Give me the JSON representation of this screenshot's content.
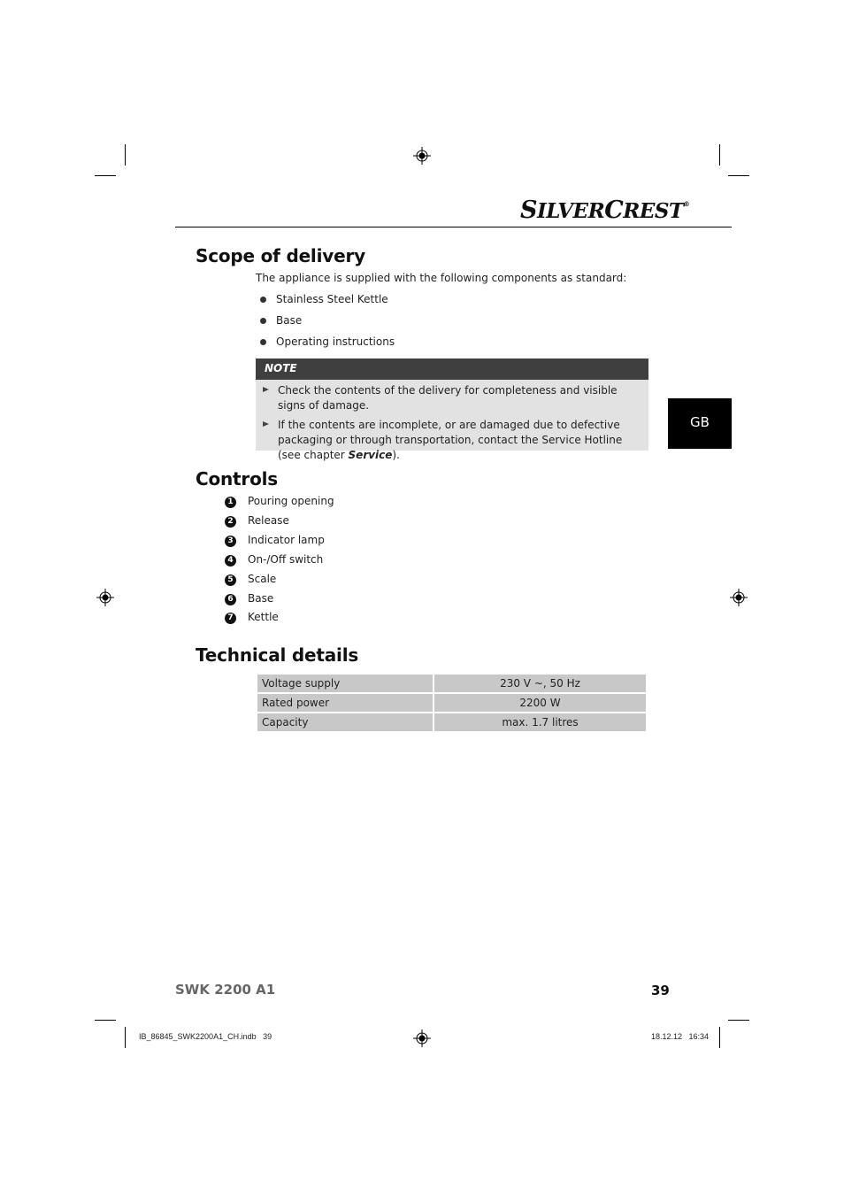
{
  "header": {
    "brand_logo": "SilverCrest",
    "brand_first": "S",
    "brand_mid": "ILVER",
    "brand_second": "C",
    "brand_rest": "REST",
    "registered": "®"
  },
  "side_tab": {
    "language": "GB"
  },
  "scope": {
    "title": "Scope of delivery",
    "intro": "The appliance is supplied with the following components as standard:",
    "items": [
      "Stainless Steel Kettle",
      "Base",
      "Operating instructions"
    ]
  },
  "note": {
    "title": "NOTE",
    "items": [
      {
        "text": "Check the contents of the delivery for completeness and visible signs of damage."
      },
      {
        "text_before": "If the contents are incomplete, or are damaged due to defective packaging or through transportation, contact the Service Hotline (see chapter ",
        "emphasis": "Service",
        "text_after": ")."
      }
    ]
  },
  "controls": {
    "title": "Controls",
    "items": [
      {
        "num": "1",
        "label": "Pouring opening"
      },
      {
        "num": "2",
        "label": "Release"
      },
      {
        "num": "3",
        "label": "Indicator lamp"
      },
      {
        "num": "4",
        "label": "On-/Off switch"
      },
      {
        "num": "5",
        "label": "Scale"
      },
      {
        "num": "6",
        "label": "Base"
      },
      {
        "num": "7",
        "label": "Kettle"
      }
    ]
  },
  "technical": {
    "title": "Technical details",
    "rows": [
      {
        "label": "Voltage supply",
        "value": "230 V ~, 50 Hz"
      },
      {
        "label": "Rated power",
        "value": "2200 W"
      },
      {
        "label": "Capacity",
        "value": "max. 1.7 litres"
      }
    ]
  },
  "footer": {
    "model": "SWK 2200 A1",
    "page_number": "39",
    "slug_file": "IB_86845_SWK2200A1_CH.indb   39",
    "slug_date": "18.12.12   16:34"
  }
}
